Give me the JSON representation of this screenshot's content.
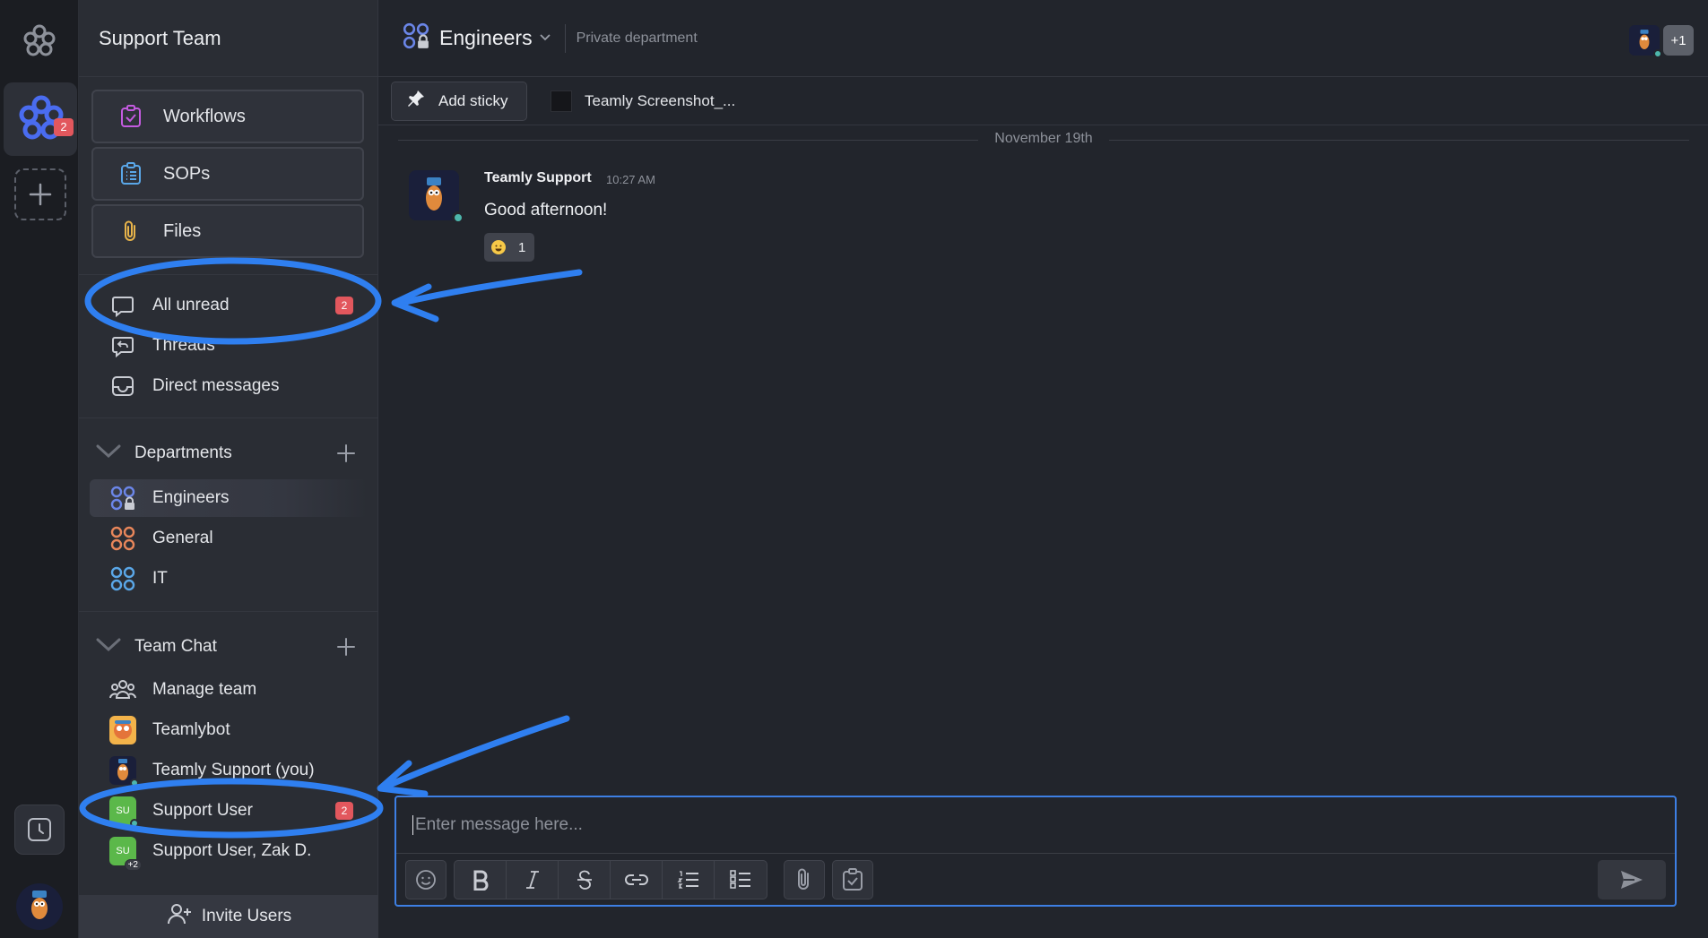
{
  "workspace": {
    "badge": "2"
  },
  "sidebar": {
    "title": "Support Team",
    "tools": [
      {
        "label": "Workflows",
        "icon": "workflow-check-icon"
      },
      {
        "label": "SOPs",
        "icon": "list-clipboard-icon"
      },
      {
        "label": "Files",
        "icon": "paperclip-icon"
      }
    ],
    "nav": [
      {
        "label": "All unread",
        "badge": "2",
        "icon": "chat-bubble-icon"
      },
      {
        "label": "Threads",
        "icon": "threads-icon"
      },
      {
        "label": "Direct messages",
        "icon": "inbox-icon"
      }
    ],
    "departments": {
      "title": "Departments",
      "items": [
        {
          "label": "Engineers",
          "color": "#6b86e8"
        },
        {
          "label": "General",
          "color": "#e8865a"
        },
        {
          "label": "IT",
          "color": "#5aa7e8"
        }
      ]
    },
    "team_chat": {
      "title": "Team Chat",
      "items": [
        {
          "label": "Manage team"
        },
        {
          "label": "Teamlybot"
        },
        {
          "label": "Teamly Support (you)"
        },
        {
          "label": "Support User",
          "badge": "2",
          "initials": "SU"
        },
        {
          "label": "Support User, Zak D.",
          "initials": "SU",
          "extra": "+2"
        }
      ]
    },
    "invite_label": "Invite Users"
  },
  "channel": {
    "title": "Engineers",
    "subtitle": "Private department",
    "members_extra": "+1"
  },
  "toolbar": {
    "add_sticky": "Add sticky",
    "file_tab": "Teamly Screenshot_..."
  },
  "messages": {
    "date": "November 19th",
    "items": [
      {
        "author": "Teamly Support",
        "time": "10:27 AM",
        "text": "Good afternoon!",
        "reaction_count": "1"
      }
    ]
  },
  "composer": {
    "placeholder": "Enter message here..."
  },
  "colors": {
    "accent": "#3d7fe3",
    "badge": "#e2575d",
    "annotation": "#2f7ff0"
  }
}
